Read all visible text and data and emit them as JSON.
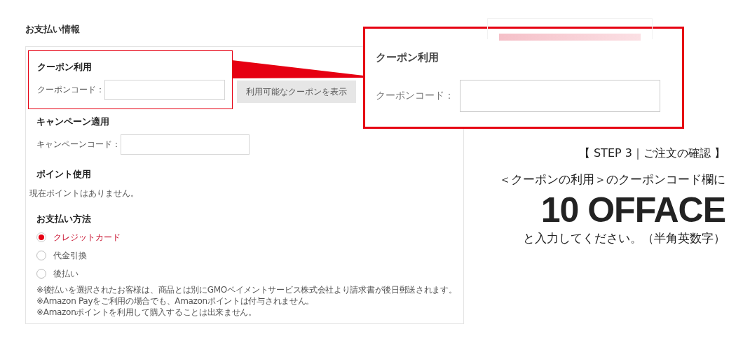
{
  "section_title": "お支払い情報",
  "coupon": {
    "heading": "クーポン利用",
    "label": "クーポンコード：",
    "button": "利用可能なクーポンを表示"
  },
  "campaign": {
    "heading": "キャンペーン適用",
    "label": "キャンペーンコード："
  },
  "points": {
    "heading": "ポイント使用",
    "message": "現在ポイントはありません。"
  },
  "payment": {
    "heading": "お支払い方法",
    "options": [
      {
        "label": "クレジットカード",
        "selected": true
      },
      {
        "label": "代金引換",
        "selected": false
      },
      {
        "label": "後払い",
        "selected": false
      }
    ],
    "notes": [
      "※後払いを選択されたお客様は、商品とは別にGMOペイメントサービス株式会社より請求書が後日郵送されます。",
      "※Amazon Payをご利用の場合でも、Amazonポイントは付与されません。",
      "※Amazonポイントを利用して購入することは出来ません。"
    ]
  },
  "zoom_callout": {
    "heading": "クーポン利用",
    "label": "クーポンコード："
  },
  "instructions": {
    "step": "【 STEP 3｜ご注文の確認 】",
    "line": "＜クーポンの利用＞のクーポンコード欄に",
    "code": "10 OFFACE",
    "note": "と入力してください。（半角英数字）"
  }
}
